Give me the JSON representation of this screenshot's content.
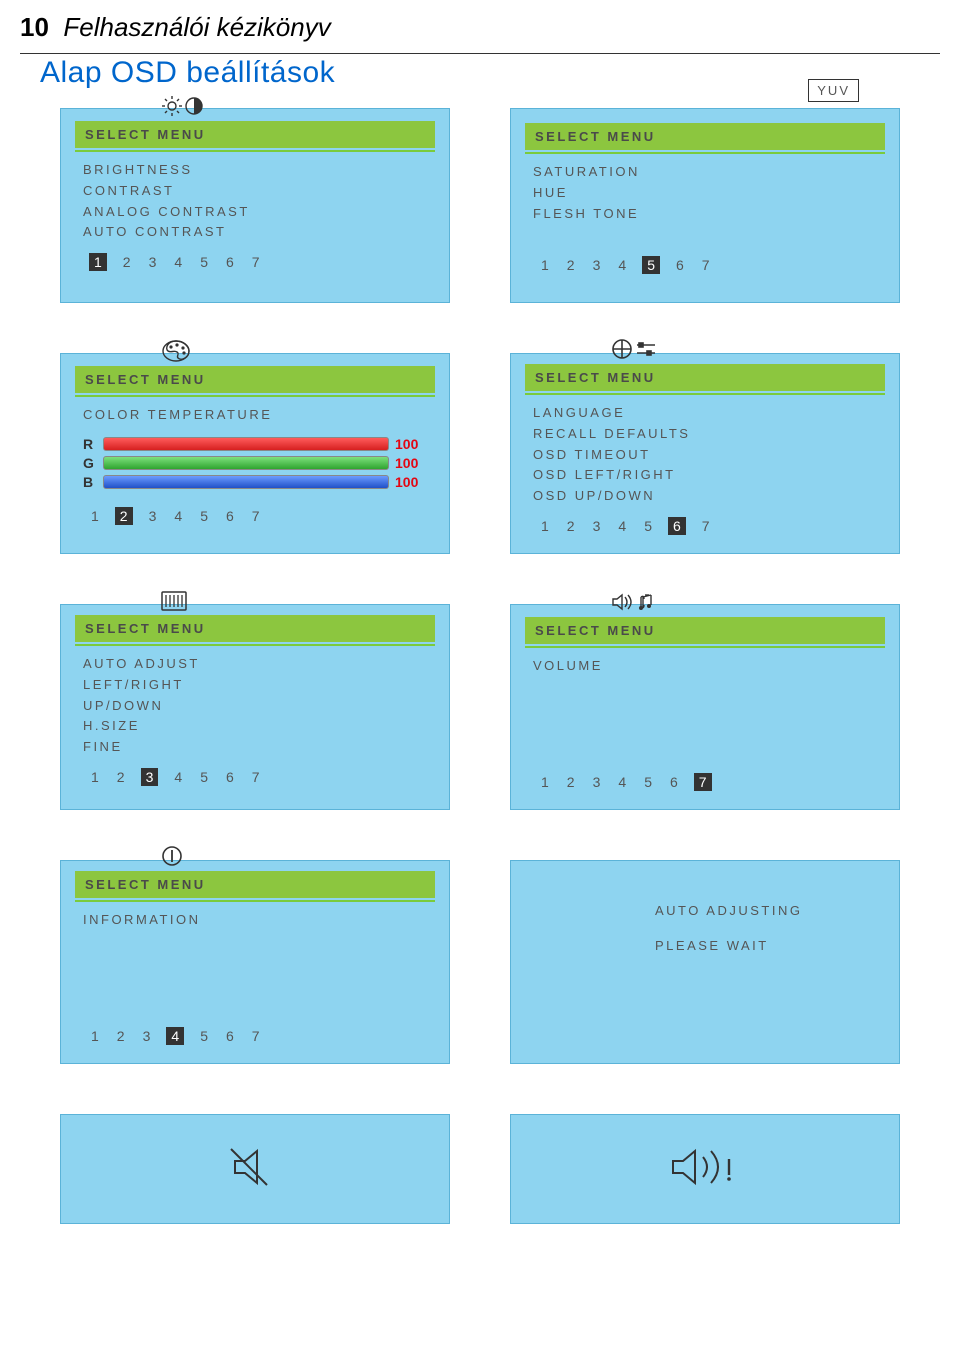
{
  "header": {
    "page_number": "10",
    "manual_title": "Felhasználói kézikönyv"
  },
  "section_title": "Alap OSD beállítások",
  "panels": {
    "brightness": {
      "title": "SELECT MENU",
      "items": [
        "BRIGHTNESS",
        "CONTRAST",
        "ANALOG CONTRAST",
        "AUTO CONTRAST"
      ],
      "tabs": [
        "1",
        "2",
        "3",
        "4",
        "5",
        "6",
        "7"
      ],
      "active_tab": 0
    },
    "yuv": {
      "tag": "YUV",
      "title": "SELECT MENU",
      "items": [
        "SATURATION",
        "HUE",
        "FLESH TONE"
      ],
      "tabs": [
        "1",
        "2",
        "3",
        "4",
        "5",
        "6",
        "7"
      ],
      "active_tab": 4
    },
    "color_temp": {
      "title": "SELECT MENU",
      "subtitle": "COLOR TEMPERATURE",
      "rgb": [
        {
          "label": "R",
          "value": "100"
        },
        {
          "label": "G",
          "value": "100"
        },
        {
          "label": "B",
          "value": "100"
        }
      ],
      "tabs": [
        "1",
        "2",
        "3",
        "4",
        "5",
        "6",
        "7"
      ],
      "active_tab": 1
    },
    "language": {
      "title": "SELECT MENU",
      "items": [
        "LANGUAGE",
        "RECALL DEFAULTS",
        "OSD TIMEOUT",
        "OSD LEFT/RIGHT",
        "OSD UP/DOWN"
      ],
      "tabs": [
        "1",
        "2",
        "3",
        "4",
        "5",
        "6",
        "7"
      ],
      "active_tab": 5
    },
    "auto_adjust": {
      "title": "SELECT MENU",
      "items": [
        "AUTO ADJUST",
        "LEFT/RIGHT",
        "UP/DOWN",
        "H.SIZE",
        "FINE"
      ],
      "tabs": [
        "1",
        "2",
        "3",
        "4",
        "5",
        "6",
        "7"
      ],
      "active_tab": 2
    },
    "volume": {
      "title": "SELECT MENU",
      "items": [
        "VOLUME"
      ],
      "tabs": [
        "1",
        "2",
        "3",
        "4",
        "5",
        "6",
        "7"
      ],
      "active_tab": 6
    },
    "information": {
      "title": "SELECT MENU",
      "items": [
        "INFORMATION"
      ],
      "tabs": [
        "1",
        "2",
        "3",
        "4",
        "5",
        "6",
        "7"
      ],
      "active_tab": 3
    },
    "auto_adjusting": {
      "line1": "AUTO ADJUSTING",
      "line2": "PLEASE WAIT"
    }
  }
}
